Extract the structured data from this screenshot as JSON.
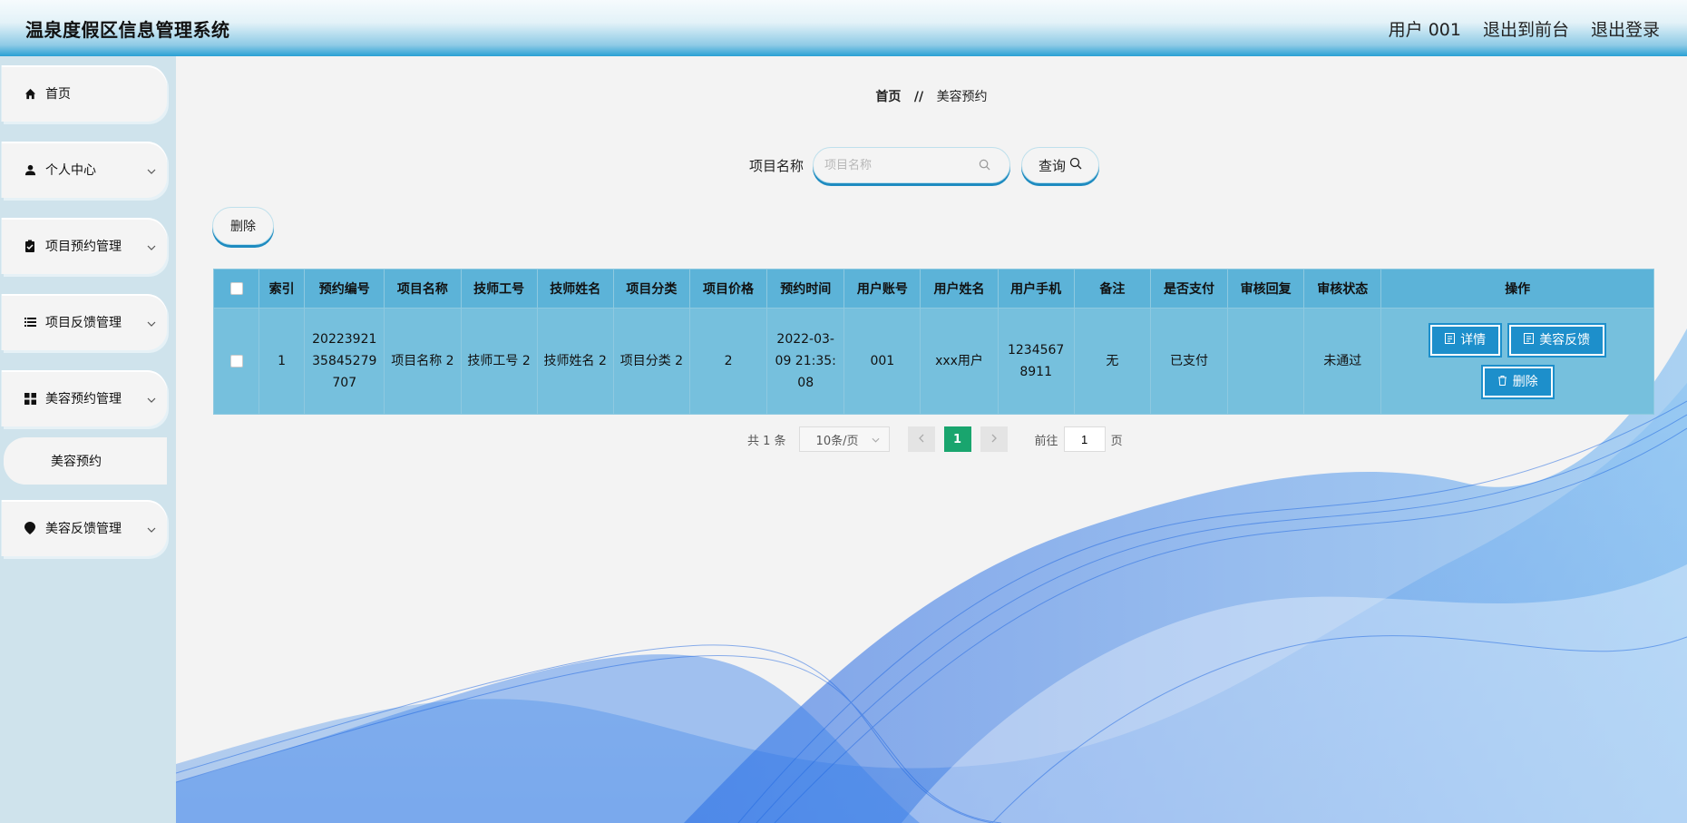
{
  "header": {
    "title": "温泉度假区信息管理系统",
    "user": "用户 001",
    "to_frontend": "退出到前台",
    "logout": "退出登录"
  },
  "sidebar": {
    "items": [
      {
        "label": "首页",
        "icon": "home-icon"
      },
      {
        "label": "个人中心",
        "icon": "user-icon"
      },
      {
        "label": "项目预约管理",
        "icon": "clipboard-icon"
      },
      {
        "label": "项目反馈管理",
        "icon": "list-icon"
      },
      {
        "label": "美容预约管理",
        "icon": "grid-icon"
      },
      {
        "label": "美容预约",
        "icon": ""
      },
      {
        "label": "美容反馈管理",
        "icon": "location-pin-icon"
      }
    ]
  },
  "breadcrumb": {
    "home": "首页",
    "separator": "//",
    "current": "美容预约"
  },
  "search": {
    "label": "项目名称",
    "placeholder": "项目名称",
    "value": "",
    "button": "查询"
  },
  "toolbar": {
    "delete_label": "删除"
  },
  "table": {
    "headers": [
      "索引",
      "预约编号",
      "项目名称",
      "技师工号",
      "技师姓名",
      "项目分类",
      "项目价格",
      "预约时间",
      "用户账号",
      "用户姓名",
      "用户手机",
      "备注",
      "是否支付",
      "审核回复",
      "审核状态",
      "操作"
    ],
    "rows": [
      {
        "index": "1",
        "booking_no": "20223921 35845279 707",
        "project_name": "项目名称 2",
        "tech_id": "技师工号 2",
        "tech_name": "技师姓名 2",
        "category": "项目分类 2",
        "price": "2",
        "time": "2022-03- 09 21:35: 08",
        "account": "001",
        "user_name": "xxx用户",
        "phone": "1234567 8911",
        "note": "无",
        "paid": "已支付",
        "reply": "",
        "status": "未通过",
        "actions": {
          "detail": "详情",
          "feedback": "美容反馈",
          "delete": "删除"
        }
      }
    ]
  },
  "pagination": {
    "total": "共 1 条",
    "page_size": "10条/页",
    "current": "1",
    "goto_prefix": "前往",
    "goto_value": "1",
    "goto_suffix": "页"
  },
  "colors": {
    "accent": "#1d8fcb",
    "header_bg": "#2aa0d4",
    "table_header": "#5cb3d8",
    "table_row": "#76c0dd",
    "active_page": "#19a56e"
  }
}
